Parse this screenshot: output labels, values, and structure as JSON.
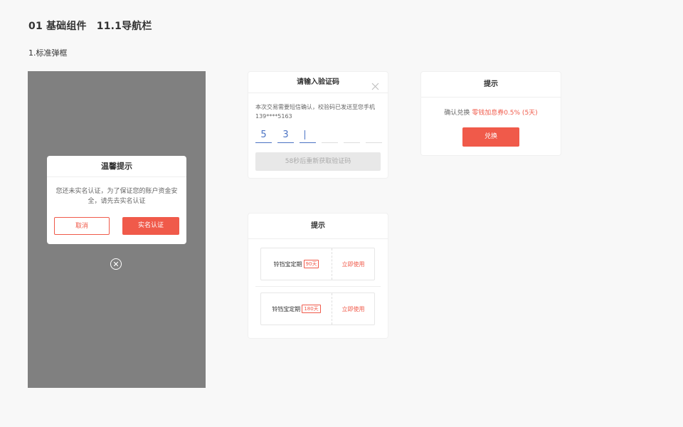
{
  "header": {
    "section": "01 基础组件",
    "page": "11.1导航栏",
    "subtitle": "1.标准弹框"
  },
  "colors": {
    "accent": "#f05a4a",
    "focus": "#4b73c4",
    "overlay": "#808080"
  },
  "realname_dialog": {
    "title": "温馨提示",
    "message": "您还未实名认证，为了保证您的账户资金安全，请先去实名认证",
    "cancel_label": "取消",
    "confirm_label": "实名认证",
    "close_icon": "close-circle-icon"
  },
  "verify_dialog": {
    "title": "请输入验证码",
    "close_icon": "close-icon",
    "message": "本次交易需要短信确认，校验码已发送至您手机139****5163",
    "digits": [
      "5",
      "3",
      "",
      "",
      "",
      ""
    ],
    "resend_label": "58秒后重新获取验证码"
  },
  "exchange_dialog": {
    "title": "提示",
    "message_prefix": "确认兑换",
    "message_highlight": "零钱加息券0.5% (5天)",
    "confirm_label": "兑换"
  },
  "product_dialog": {
    "title": "提示",
    "items": [
      {
        "name": "铃铛宝定期",
        "tag": "90天",
        "action": "立即使用"
      },
      {
        "name": "铃铛宝定期",
        "tag": "180天",
        "action": "立即使用"
      }
    ]
  }
}
